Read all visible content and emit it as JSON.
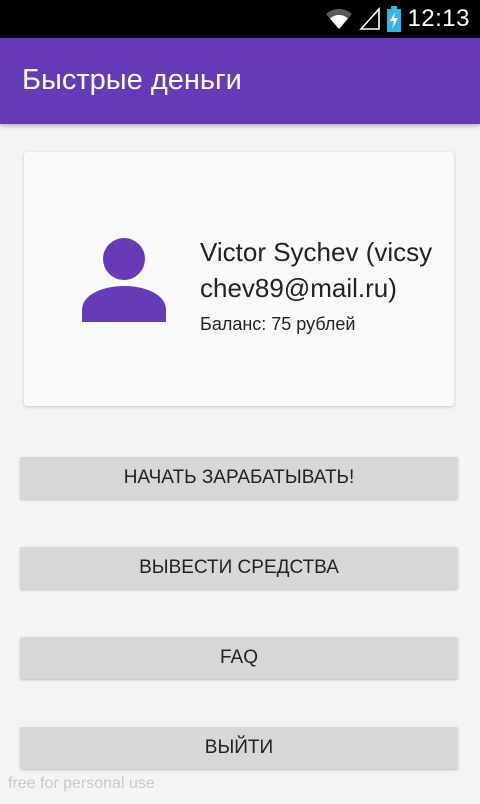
{
  "status_bar": {
    "time": "12:13",
    "icons": [
      "wifi-icon",
      "signal-icon",
      "battery-charging-icon"
    ]
  },
  "app_bar": {
    "title": "Быстрые деньги",
    "color": "#673ab7"
  },
  "profile": {
    "name_line": "Victor Sychev (vicsychev89@mail.ru)",
    "balance": "Баланс: 75 рублей",
    "avatar_icon": "person-icon",
    "avatar_color": "#673ab7"
  },
  "buttons": {
    "earn": "НАЧАТЬ ЗАРАБАТЫВАТЬ!",
    "withdraw": "ВЫВЕСТИ СРЕДСТВА",
    "faq": "FAQ",
    "exit": "ВЫЙТИ"
  },
  "watermark": "free for personal use"
}
